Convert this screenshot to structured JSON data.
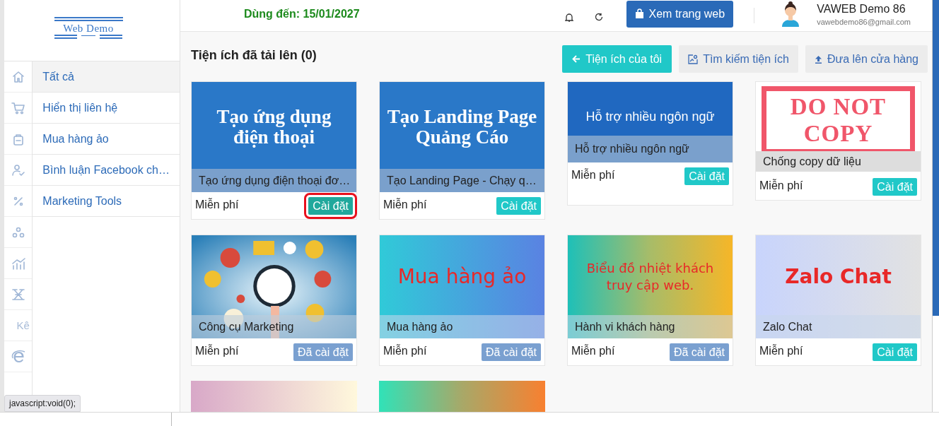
{
  "logo": {
    "text": "Web Demo"
  },
  "rail": [
    {
      "kind": "icon"
    },
    {
      "kind": "icon"
    },
    {
      "kind": "icon"
    },
    {
      "kind": "icon"
    },
    {
      "kind": "icon"
    },
    {
      "kind": "icon"
    },
    {
      "kind": "icon"
    },
    {
      "kind": "icon"
    },
    {
      "kind": "text",
      "label": "Kê"
    },
    {
      "kind": "icon"
    }
  ],
  "menu": [
    {
      "label": "Tất cả",
      "selected": true
    },
    {
      "label": "Hiển thị liên hệ",
      "selected": false
    },
    {
      "label": "Mua hàng ảo",
      "selected": false
    },
    {
      "label": "Bình luận Facebook ch…",
      "selected": false
    },
    {
      "label": "Marketing Tools",
      "selected": false
    }
  ],
  "header": {
    "expiry": "Dùng đến: 15/01/2027",
    "view_site_button": "Xem trang web",
    "user": {
      "name": "VAWEB Demo 86",
      "email": "vawebdemo86@gmail.com"
    }
  },
  "page_title": "Tiện ích đã tải lên (0)",
  "actions": [
    {
      "label": "Tiện ích của tôi",
      "kind": "primary"
    },
    {
      "label": "Tìm kiếm tiện ích",
      "kind": "search"
    },
    {
      "label": "Đưa lên cửa hàng",
      "kind": "upload"
    }
  ],
  "cards": [
    {
      "banner": {
        "kind": "serif",
        "text": "Tạo ứng dụng điện thoại"
      },
      "caption": "Tạo ứng dụng điện thoại đơ…",
      "price": "Miễn phí",
      "button": "Cài đặt",
      "installed": false,
      "highlighted": true
    },
    {
      "banner": {
        "kind": "serif",
        "text": "Tạo Landing Page Quảng Cáo"
      },
      "caption": "Tạo Landing Page - Chạy q…",
      "price": "Miễn phí",
      "button": "Cài đặt",
      "installed": false,
      "highlighted": false
    },
    {
      "banner": {
        "kind": "sans",
        "text": "Hỗ trợ nhiều ngôn ngữ"
      },
      "caption": "Hỗ trợ nhiều ngôn ngữ",
      "price": "Miễn phí",
      "button": "Cài đặt",
      "installed": false,
      "highlighted": false
    },
    {
      "banner": {
        "kind": "stamp",
        "text": "DO NOT COPY"
      },
      "caption": "Chống copy dữ liệu",
      "price": "Miễn phí",
      "button": "Cài đặt",
      "installed": false,
      "highlighted": false
    },
    {
      "caption": "Công cụ Marketing",
      "price": "Miễn phí",
      "button": "Đã cài đặt",
      "installed": true,
      "highlighted": false
    },
    {
      "banner": {
        "kind": "red-large",
        "text": "Mua hàng ảo"
      },
      "caption": "Mua hàng ảo",
      "price": "Miễn phí",
      "button": "Đã cài đặt",
      "installed": true,
      "highlighted": false
    },
    {
      "banner": {
        "kind": "red-small",
        "text": "Biểu đồ nhiệt khách truy cập web."
      },
      "caption": "Hành vi khách hàng",
      "price": "Miễn phí",
      "button": "Đã cài đặt",
      "installed": true,
      "highlighted": false
    },
    {
      "banner": {
        "kind": "red-bold",
        "text": "Zalo Chat"
      },
      "caption": "Zalo Chat",
      "price": "Miễn phí",
      "button": "Cài đặt",
      "installed": false,
      "highlighted": false
    },
    {
      "banner": {
        "kind": "plain"
      }
    },
    {
      "banner": {
        "kind": "plain"
      }
    }
  ],
  "status_tooltip": "javascript:void(0);"
}
